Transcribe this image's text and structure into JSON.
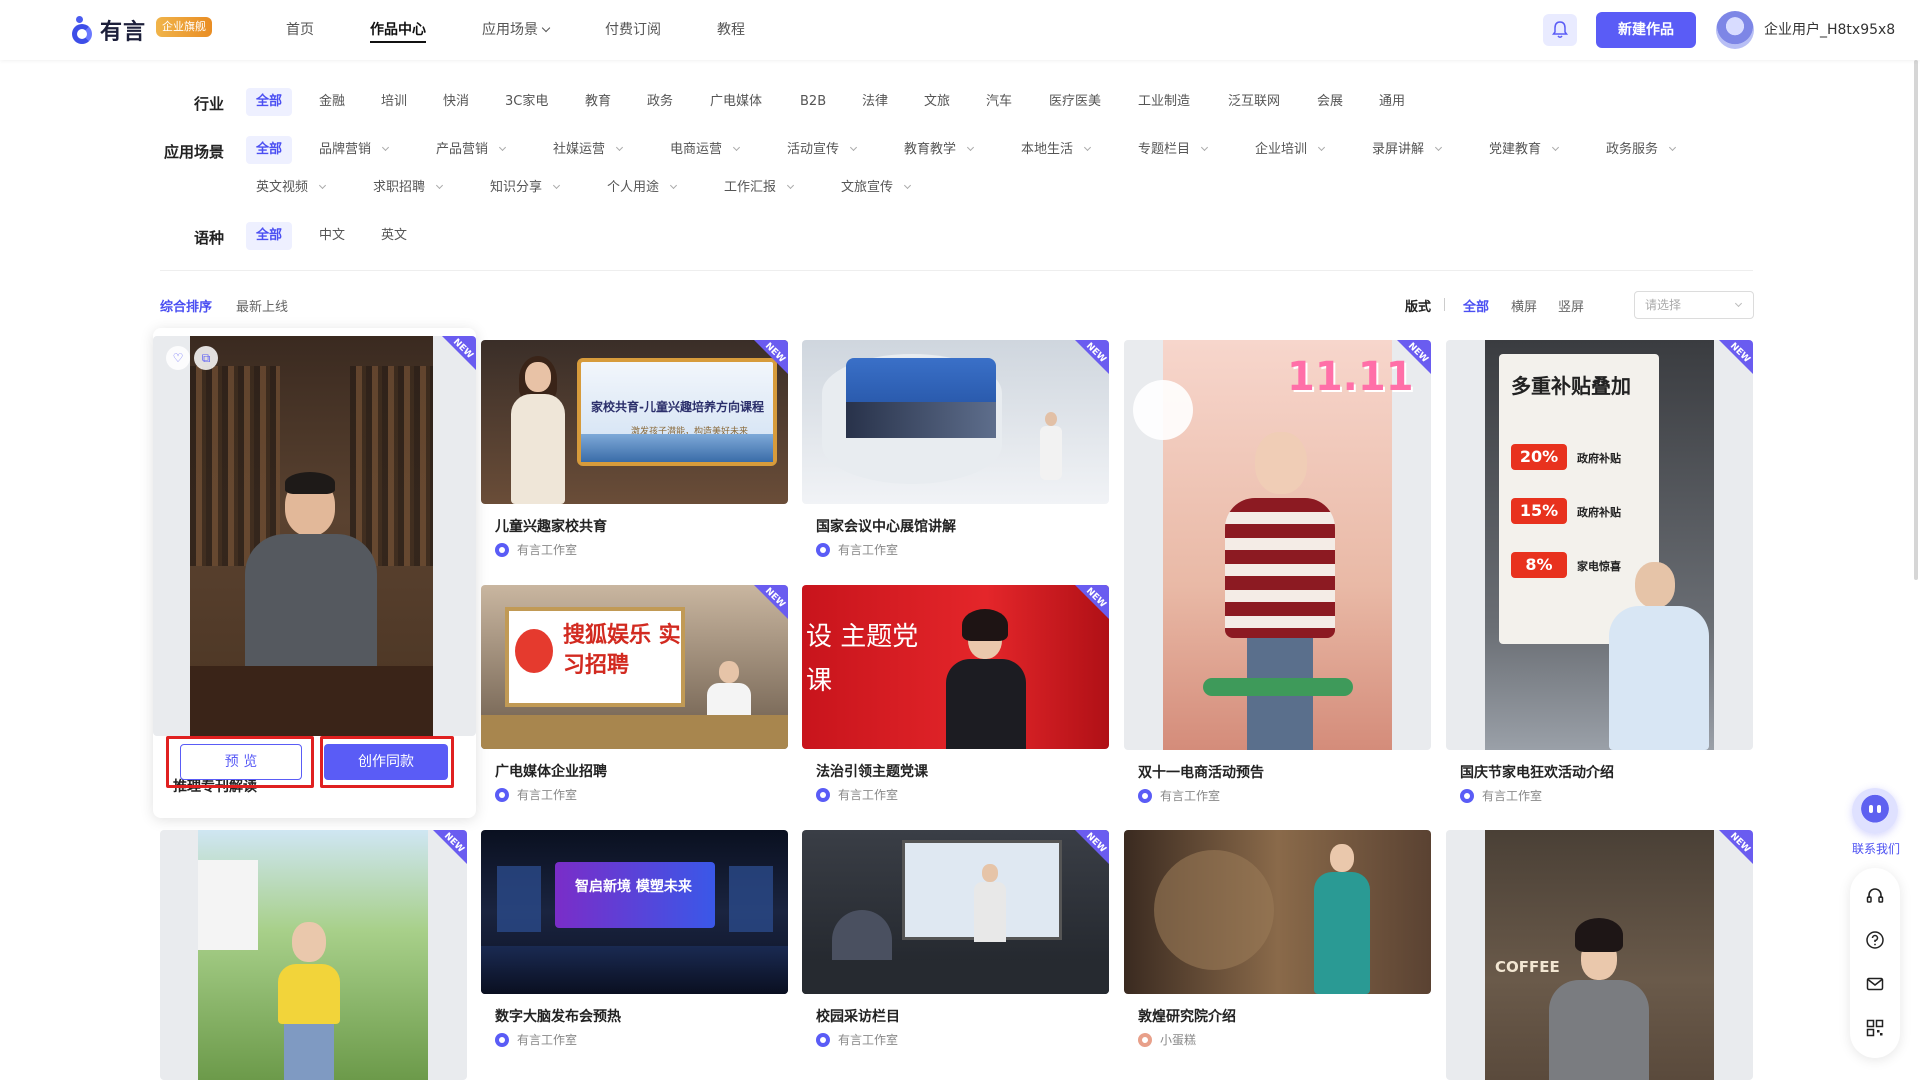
{
  "header": {
    "logo_text": "有言",
    "badge": "企业旗舰",
    "nav": [
      "首页",
      "作品中心",
      "应用场景",
      "付费订阅",
      "教程"
    ],
    "active_nav": "作品中心",
    "new_button": "新建作品",
    "username": "企业用户_H8tx95x8"
  },
  "filters": {
    "industry_label": "行业",
    "industry": [
      "全部",
      "金融",
      "培训",
      "快消",
      "3C家电",
      "教育",
      "政务",
      "广电媒体",
      "B2B",
      "法律",
      "文旅",
      "汽车",
      "医疗医美",
      "工业制造",
      "泛互联网",
      "会展",
      "通用"
    ],
    "scene_label": "应用场景",
    "scene": [
      "全部",
      "品牌营销",
      "产品营销",
      "社媒运营",
      "电商运营",
      "活动宣传",
      "教育教学",
      "本地生活",
      "专题栏目",
      "企业培训",
      "录屏讲解",
      "党建教育",
      "政务服务",
      "英文视频",
      "求职招聘",
      "知识分享",
      "个人用途",
      "工作汇报",
      "文旅宣传"
    ],
    "lang_label": "语种",
    "lang": [
      "全部",
      "中文",
      "英文"
    ]
  },
  "sort": {
    "items": [
      "综合排序",
      "最新上线"
    ],
    "format_label": "版式",
    "formats": [
      "全部",
      "横屏",
      "竖屏"
    ],
    "select_placeholder": "请选择"
  },
  "hover_card": {
    "title": "推理专刊解读",
    "preview": "预 览",
    "create": "创作同款"
  },
  "cards": [
    {
      "title": "儿童兴趣家校共育",
      "author": "有言工作室",
      "caption": "家校共育-儿童兴趣培养方向课程",
      "sub": "激发孩子潜能，构造美好未来"
    },
    {
      "title": "国家会议中心展馆讲解",
      "author": "有言工作室"
    },
    {
      "title": "双十一电商活动预告",
      "author": "有言工作室",
      "big": "11.11"
    },
    {
      "title": "国庆节家电狂欢活动介绍",
      "author": "有言工作室",
      "headline": "多重补贴叠加",
      "lines": [
        "20%",
        "政府补贴",
        "15%",
        "政府补贴",
        "8%",
        "家电惊喜"
      ]
    },
    {
      "title": "广电媒体企业招聘",
      "author": "有言工作室",
      "big": "搜狐娱乐 实习招聘"
    },
    {
      "title": "法治引领主题党课",
      "author": "有言工作室",
      "big": "设 主题党课"
    },
    {
      "title": "数字大脑发布会预热",
      "author": "有言工作室",
      "big": "智启新境 模塑未来"
    },
    {
      "title": "校园采访栏目",
      "author": "有言工作室"
    },
    {
      "title": "敦煌研究院介绍",
      "author": "小蛋糕"
    },
    {
      "title": "",
      "author": "",
      "big": "COFFEE"
    }
  ],
  "new_label": "NEW",
  "contact": "联系我们"
}
